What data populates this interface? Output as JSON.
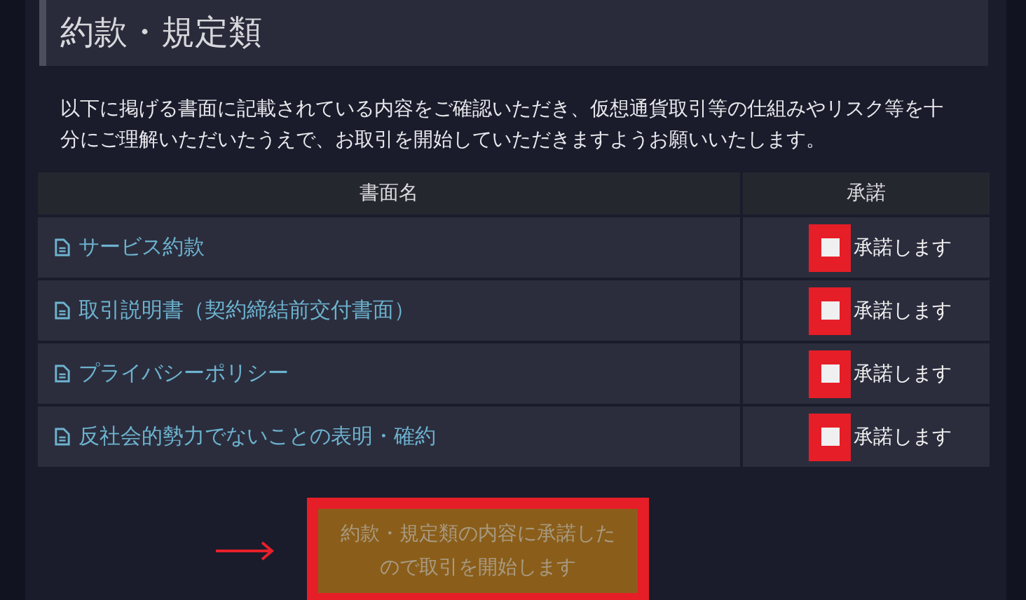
{
  "section": {
    "title": "約款・規定類"
  },
  "intro": "以下に掲げる書面に記載されている内容をご確認いただき、仮想通貨取引等の仕組みやリスク等を十分にご理解いただいたうえで、お取引を開始していただきますようお願いいたします。",
  "table": {
    "columns": [
      "書面名",
      "承諾"
    ],
    "rows": [
      {
        "document": "サービス約款",
        "accept_label": "承諾します",
        "checked": false,
        "highlighted": true
      },
      {
        "document": "取引説明書（契約締結前交付書面）",
        "accept_label": "承諾します",
        "checked": false,
        "highlighted": true
      },
      {
        "document": "プライバシーポリシー",
        "accept_label": "承諾します",
        "checked": false,
        "highlighted": true
      },
      {
        "document": "反社会的勢力でないことの表明・確約",
        "accept_label": "承諾します",
        "checked": false,
        "highlighted": true
      }
    ]
  },
  "start_button": {
    "label": "約款・規定類の内容に承諾したので取引を開始します",
    "disabled": true,
    "highlighted": true
  }
}
